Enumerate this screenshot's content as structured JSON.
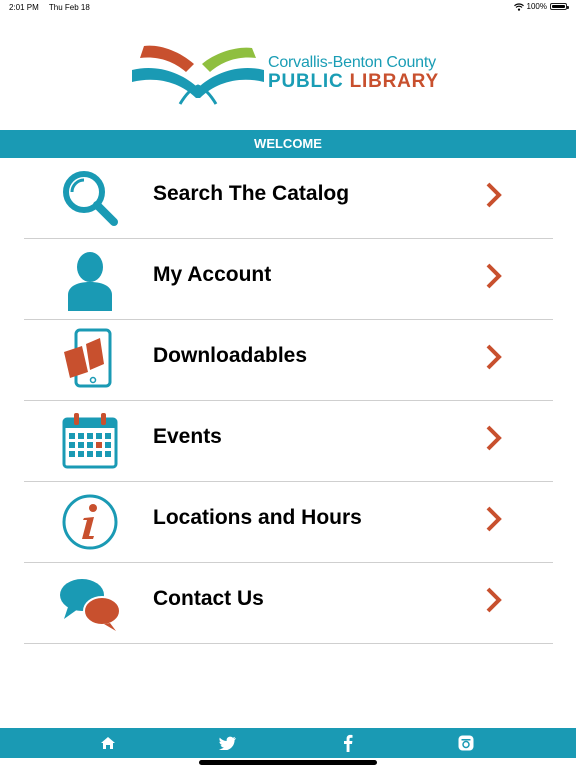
{
  "status_bar": {
    "time": "2:01 PM",
    "date": "Thu Feb 18",
    "battery": "100%",
    "battery_level": 1.0
  },
  "logo": {
    "line1": "Corvallis-Benton County",
    "line2a": "PUBLIC",
    "line2b": "LIBRARY"
  },
  "welcome": "WELCOME",
  "menu": [
    {
      "label": "Search The Catalog",
      "icon": "magnifier-icon"
    },
    {
      "label": "My Account",
      "icon": "person-icon"
    },
    {
      "label": "Downloadables",
      "icon": "tablet-book-icon"
    },
    {
      "label": "Events",
      "icon": "calendar-icon"
    },
    {
      "label": "Locations and Hours",
      "icon": "info-icon"
    },
    {
      "label": "Contact Us",
      "icon": "chat-bubbles-icon"
    }
  ],
  "tab_bar": {
    "tabs": [
      "home-icon",
      "twitter-icon",
      "facebook-icon",
      "instagram-icon"
    ]
  },
  "colors": {
    "teal": "#1a9ab4",
    "orange": "#c8502e",
    "green": "#8fbf3f"
  }
}
